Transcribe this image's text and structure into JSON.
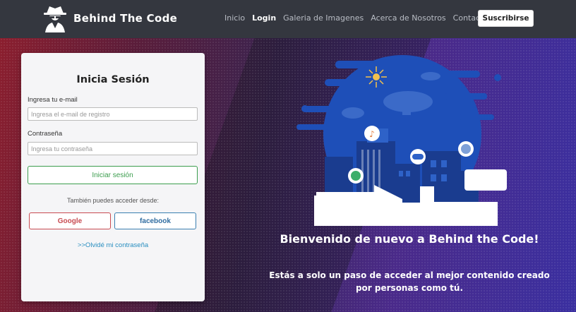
{
  "brand": {
    "name": "Behind The Code",
    "logo_icon": "spy-hacker-icon"
  },
  "nav": {
    "links": [
      {
        "label": "Inicio",
        "active": false
      },
      {
        "label": "Login",
        "active": true
      },
      {
        "label": "Galeria de Imagenes",
        "active": false
      },
      {
        "label": "Acerca de Nosotros",
        "active": false
      },
      {
        "label": "Contacto",
        "active": false
      }
    ],
    "subscribe_label": "Suscribirse"
  },
  "login": {
    "title": "Inicia Sesión",
    "email_label": "Ingresa tu e-mail",
    "email_placeholder": "Ingresa el e-mail de registro",
    "password_label": "Contraseña",
    "password_placeholder": "Ingresa tu contraseña",
    "submit_label": "Iniciar sesión",
    "alt_text": "También puedes acceder desde:",
    "google_label": "Google",
    "facebook_label": "facebook",
    "forgot_label": ">>Olvidé mi contraseña"
  },
  "hero": {
    "heading": "Bienvenido de nuevo a Behind the Code!",
    "subheading": "Estás a solo un paso de acceder al mejor contenido creado por personas como tú."
  },
  "colors": {
    "navbar": "#34373f",
    "login_green": "#3c9d4e",
    "google_red": "#c84a50",
    "facebook_blue": "#3a7fb0",
    "link_blue": "#2a8fc0"
  }
}
